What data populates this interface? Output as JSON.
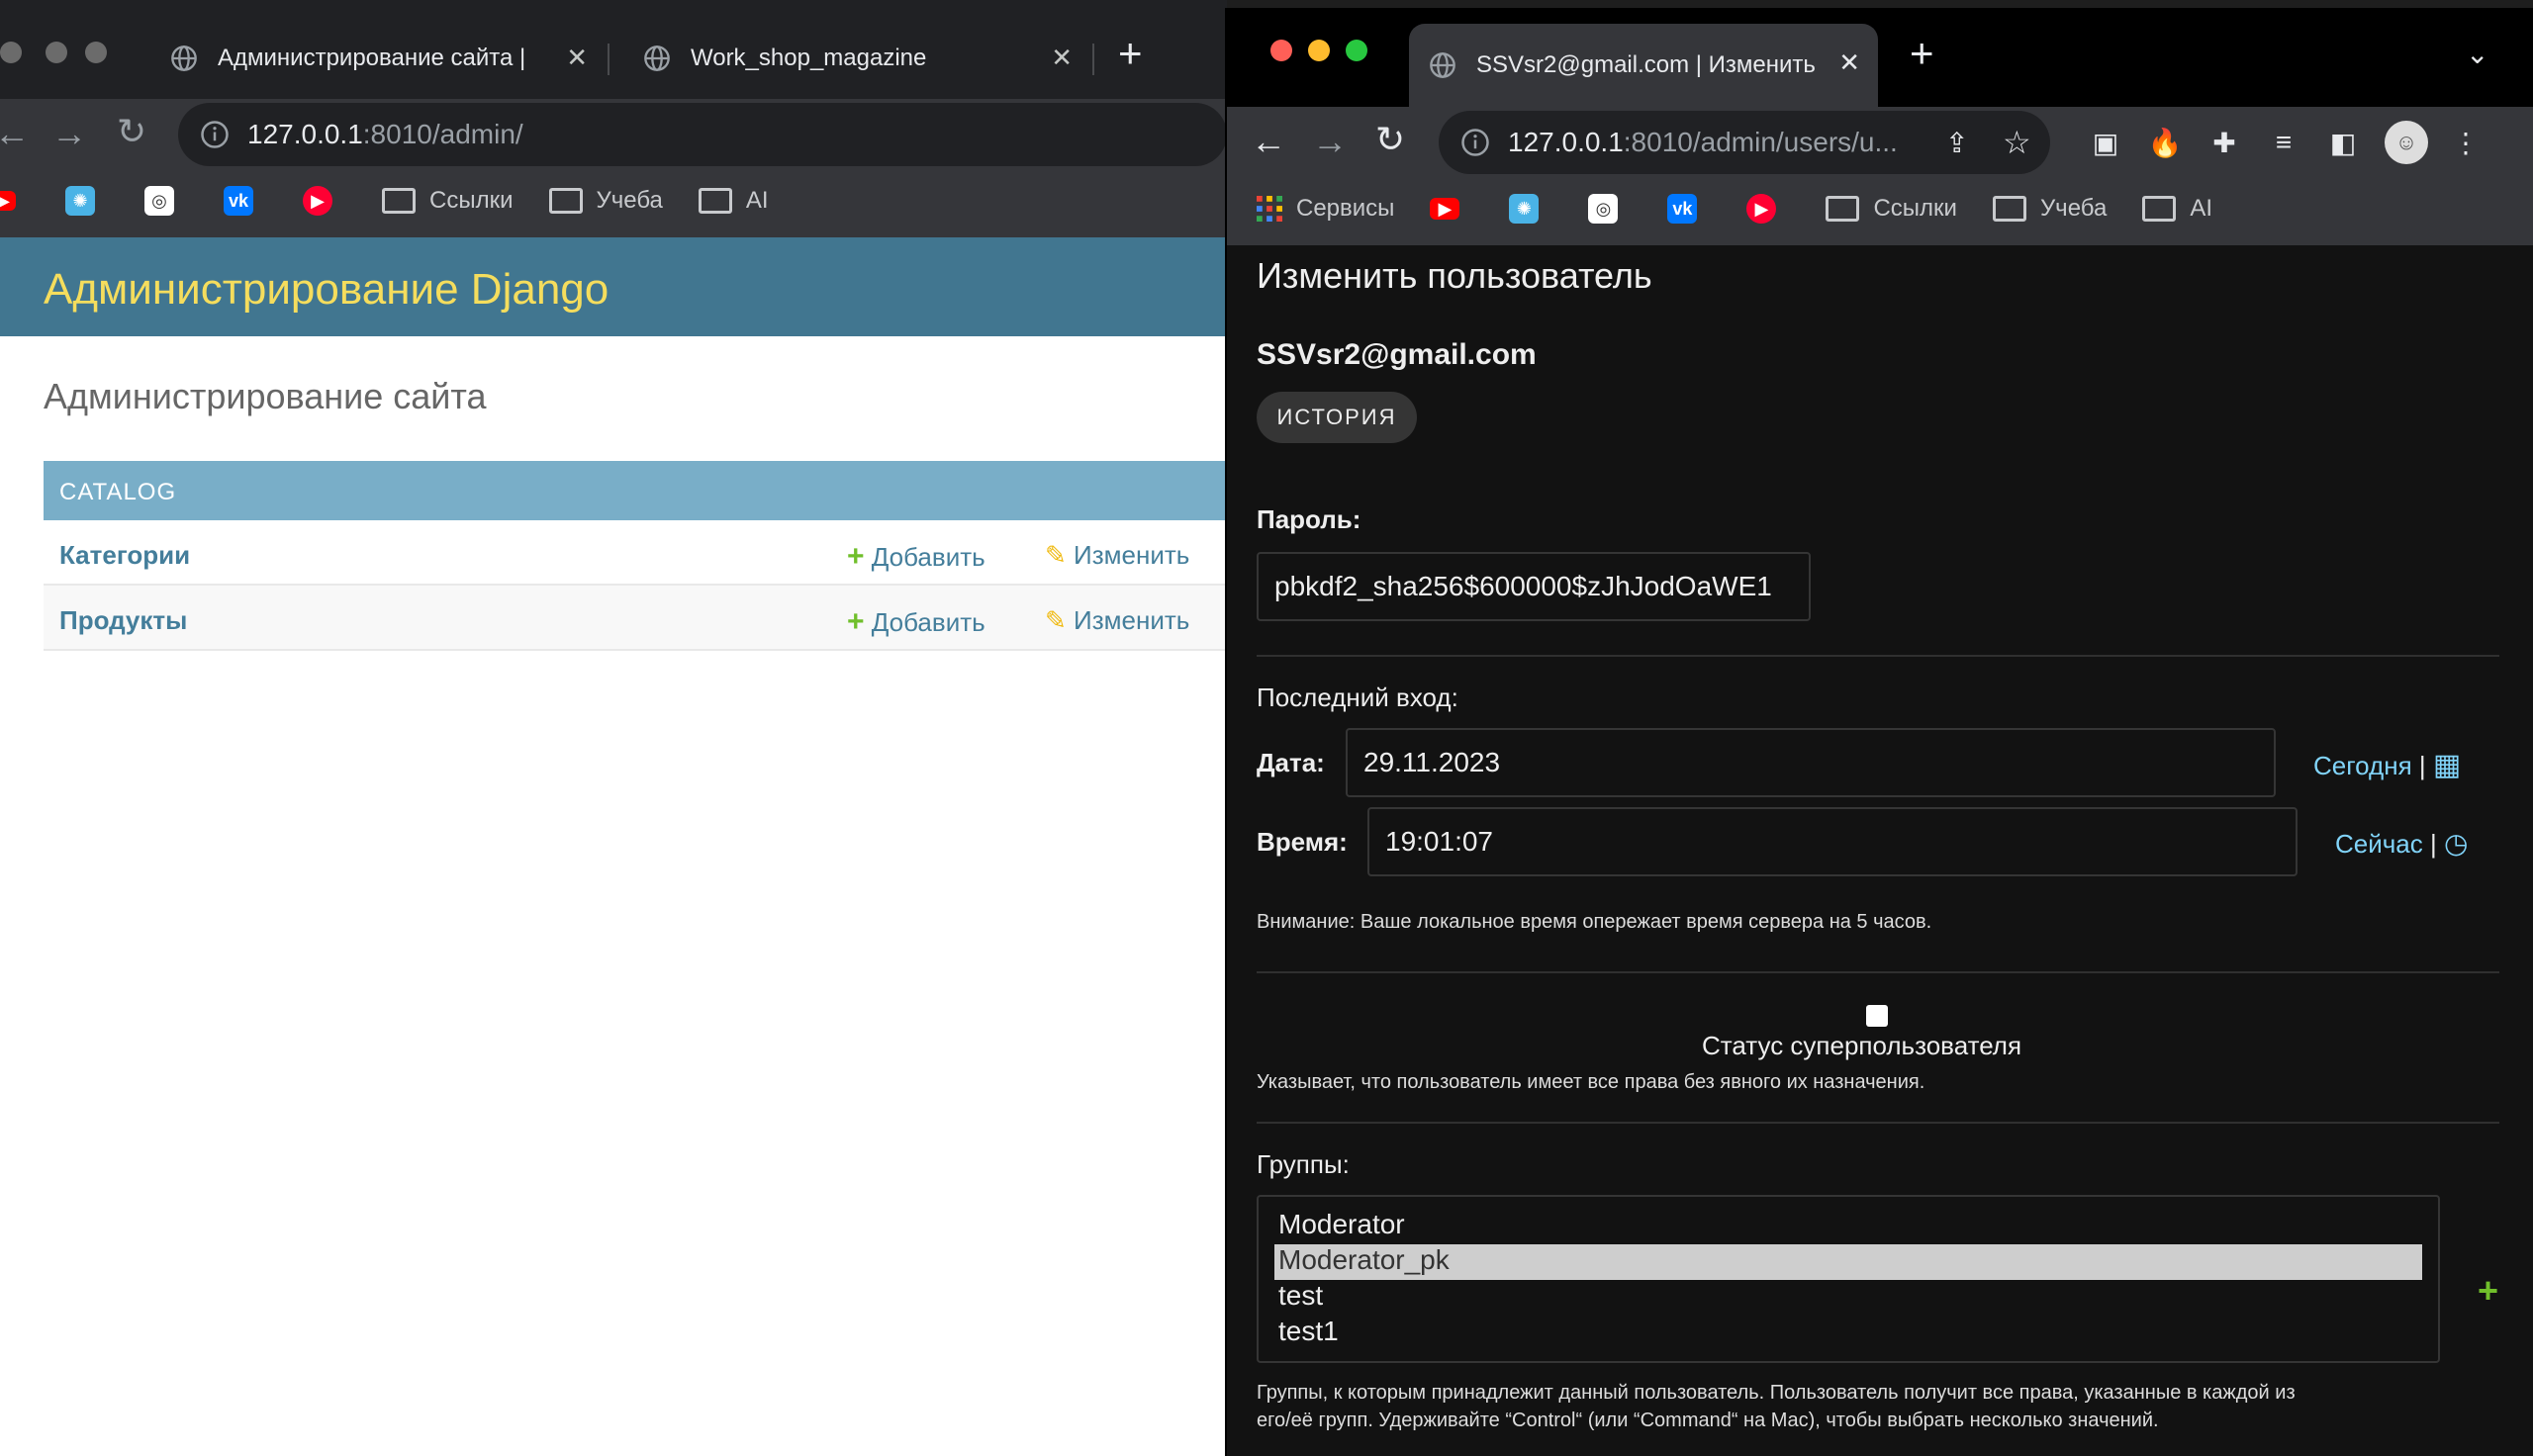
{
  "left_window": {
    "tabs": [
      {
        "title": "Администрирование сайта |"
      },
      {
        "title": "Work_shop_magazine"
      }
    ],
    "address": {
      "host": "127.0.0.1",
      "path": ":8010/admin/"
    },
    "bookmarks": [
      "Ссылки",
      "Учеба",
      "AI"
    ],
    "site_header": "Администрирование Django",
    "page_title": "Администрирование сайта",
    "module": {
      "caption": "CATALOG",
      "rows": [
        {
          "name": "Категории",
          "add": "Добавить",
          "change": "Изменить"
        },
        {
          "name": "Продукты",
          "add": "Добавить",
          "change": "Изменить"
        }
      ]
    }
  },
  "right_window": {
    "tab_title": "SSVsr2@gmail.com | Изменить",
    "address": {
      "host": "127.0.0.1",
      "path": ":8010/admin/users/u..."
    },
    "bookmarks": [
      "Сервисы",
      "Ссылки",
      "Учеба",
      "AI"
    ],
    "form": {
      "heading": "Изменить пользователь",
      "user_email": "SSVsr2@gmail.com",
      "history_button": "ИСТОРИЯ",
      "password_label": "Пароль:",
      "password_value": "pbkdf2_sha256$600000$zJhJodOaWE1",
      "last_login_label": "Последний вход:",
      "date_label": "Дата:",
      "date_value": "29.11.2023",
      "today_link": "Сегодня",
      "time_label": "Время:",
      "time_value": "19:01:07",
      "now_link": "Сейчас",
      "timezone_note": "Внимание: Ваше локальное время опережает время сервера на 5 часов.",
      "superuser_label": "Статус суперпользователя",
      "superuser_checked": false,
      "superuser_help": "Указывает, что пользователь имеет все права без явного их назначения.",
      "groups_label": "Группы:",
      "groups": [
        {
          "name": "Moderator",
          "selected": false
        },
        {
          "name": "Moderator_pk",
          "selected": true
        },
        {
          "name": "test",
          "selected": false
        },
        {
          "name": "test1",
          "selected": false
        }
      ],
      "groups_help_1": "Группы, к которым принадлежит данный пользователь. Пользователь получит все права, указанные в каждой из",
      "groups_help_2": "его/её групп. Удерживайте “Control“ (или “Command“ на Mac), чтобы выбрать несколько значений."
    }
  },
  "colors": {
    "django_header": "#417690",
    "django_title": "#f5dd5d",
    "module_caption": "#79aec8",
    "link": "#447e9b",
    "add_green": "#70bf2b",
    "dark_link": "#81d4fa"
  }
}
